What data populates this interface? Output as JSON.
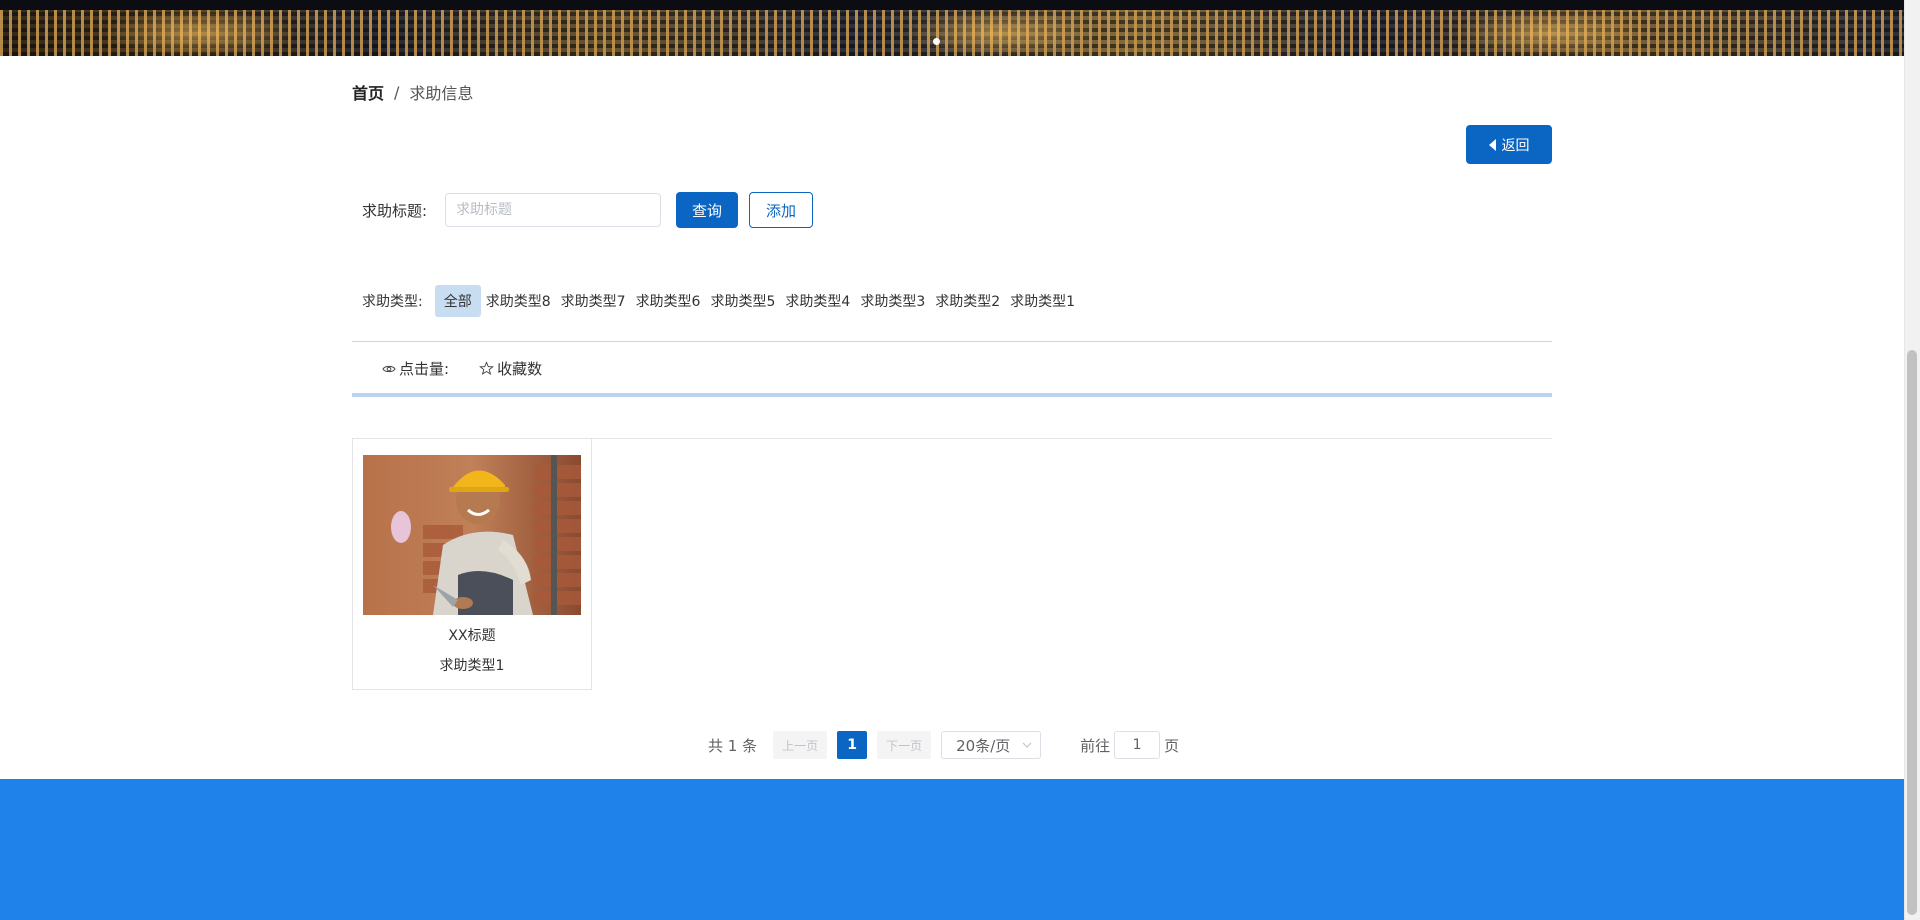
{
  "breadcrumb": {
    "home": "首页",
    "separator": "/",
    "current": "求助信息"
  },
  "back_button": {
    "label": "返回",
    "icon": "caret-left-icon"
  },
  "search": {
    "label": "求助标题:",
    "placeholder": "求助标题",
    "value": "",
    "query_label": "查询",
    "add_label": "添加"
  },
  "types": {
    "label": "求助类型:",
    "items": [
      {
        "label": "全部",
        "active": true
      },
      {
        "label": "求助类型8"
      },
      {
        "label": "求助类型7"
      },
      {
        "label": "求助类型6"
      },
      {
        "label": "求助类型5"
      },
      {
        "label": "求助类型4"
      },
      {
        "label": "求助类型3"
      },
      {
        "label": "求助类型2"
      },
      {
        "label": "求助类型1"
      }
    ]
  },
  "sort": {
    "clicks_label": "点击量:",
    "clicks_icon": "eye-icon",
    "favorites_label": "收藏数",
    "favorites_icon": "star-icon"
  },
  "cards": [
    {
      "title": "XX标题",
      "type": "求助类型1",
      "image": "construction-worker-photo"
    }
  ],
  "pagination": {
    "total": "共 1 条",
    "prev": "上一页",
    "current_page": "1",
    "next": "下一页",
    "page_size": "20条/页",
    "goto_prefix": "前往",
    "goto_value": "1",
    "goto_suffix": "页"
  },
  "colors": {
    "primary": "#0a66c2",
    "footer": "#1e82ea",
    "active_type_bg": "#c9ddf2"
  }
}
